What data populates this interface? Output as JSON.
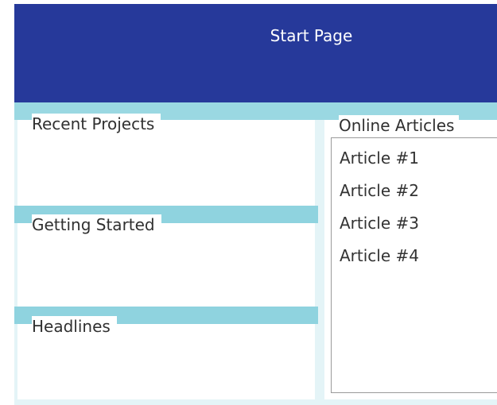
{
  "header": {
    "title": "Start Page"
  },
  "left_sections": [
    {
      "label": "Recent Projects"
    },
    {
      "label": "Getting Started"
    },
    {
      "label": "Headlines"
    }
  ],
  "online_articles": {
    "title": "Online Articles",
    "items": [
      "Article #1",
      "Article #2",
      "Article #3",
      "Article #4"
    ]
  },
  "colors": {
    "header_bg": "#26399a",
    "band": "#9ad8e2",
    "text": "#303030"
  }
}
